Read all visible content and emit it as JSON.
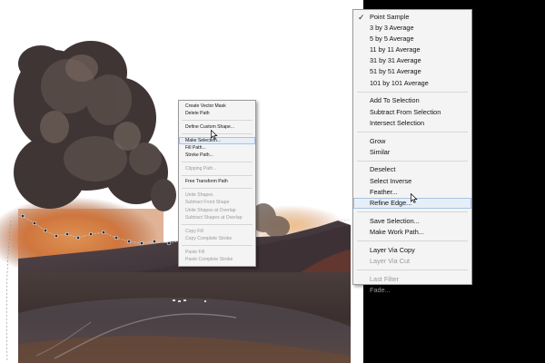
{
  "context_menu": {
    "groups": [
      [
        {
          "label": "Create Vector Mask",
          "enabled": true
        },
        {
          "label": "Delete Path",
          "enabled": true
        }
      ],
      [
        {
          "label": "Define Custom Shape...",
          "enabled": true
        }
      ],
      [
        {
          "label": "Make Selection...",
          "enabled": true,
          "highlighted": true
        },
        {
          "label": "Fill Path...",
          "enabled": true
        },
        {
          "label": "Stroke Path...",
          "enabled": true
        }
      ],
      [
        {
          "label": "Clipping Path...",
          "enabled": false
        }
      ],
      [
        {
          "label": "Free Transform Path",
          "enabled": true
        }
      ],
      [
        {
          "label": "Unite Shapes",
          "enabled": false
        },
        {
          "label": "Subtract Front Shape",
          "enabled": false
        },
        {
          "label": "Unite Shapes at Overlap",
          "enabled": false
        },
        {
          "label": "Subtract Shapes at Overlap",
          "enabled": false
        }
      ],
      [
        {
          "label": "Copy Fill",
          "enabled": false
        },
        {
          "label": "Copy Complete Stroke",
          "enabled": false
        }
      ],
      [
        {
          "label": "Paste Fill",
          "enabled": false
        },
        {
          "label": "Paste Complete Stroke",
          "enabled": false
        }
      ]
    ]
  },
  "select_menu": {
    "check_glyph": "✓",
    "groups": [
      [
        {
          "label": "Point Sample",
          "enabled": true,
          "checked": true
        },
        {
          "label": "3 by 3 Average",
          "enabled": true
        },
        {
          "label": "5 by 5 Average",
          "enabled": true
        },
        {
          "label": "11 by 11 Average",
          "enabled": true
        },
        {
          "label": "31 by 31 Average",
          "enabled": true
        },
        {
          "label": "51 by 51 Average",
          "enabled": true
        },
        {
          "label": "101 by 101 Average",
          "enabled": true
        }
      ],
      [
        {
          "label": "Add To Selection",
          "enabled": true
        },
        {
          "label": "Subtract From Selection",
          "enabled": true
        },
        {
          "label": "Intersect Selection",
          "enabled": true
        }
      ],
      [
        {
          "label": "Grow",
          "enabled": true
        },
        {
          "label": "Similar",
          "enabled": true
        }
      ],
      [
        {
          "label": "Deselect",
          "enabled": true
        },
        {
          "label": "Select Inverse",
          "enabled": true
        },
        {
          "label": "Feather...",
          "enabled": true
        },
        {
          "label": "Refine Edge...",
          "enabled": true,
          "highlighted": true
        }
      ],
      [
        {
          "label": "Save Selection...",
          "enabled": true
        },
        {
          "label": "Make Work Path...",
          "enabled": true
        }
      ],
      [
        {
          "label": "Layer Via Copy",
          "enabled": true
        },
        {
          "label": "Layer Via Cut",
          "enabled": false
        }
      ],
      [
        {
          "label": "Last Filter",
          "enabled": false
        },
        {
          "label": "Fade...",
          "enabled": false
        }
      ]
    ]
  },
  "colors": {
    "menu_bg": "#f4f4f4",
    "highlight_bg": "#e6eef8",
    "highlight_border": "#a9c3e4",
    "disabled_text": "#9a9a9a",
    "canvas_bg": "#ffffff",
    "workspace_bg": "#000000"
  }
}
